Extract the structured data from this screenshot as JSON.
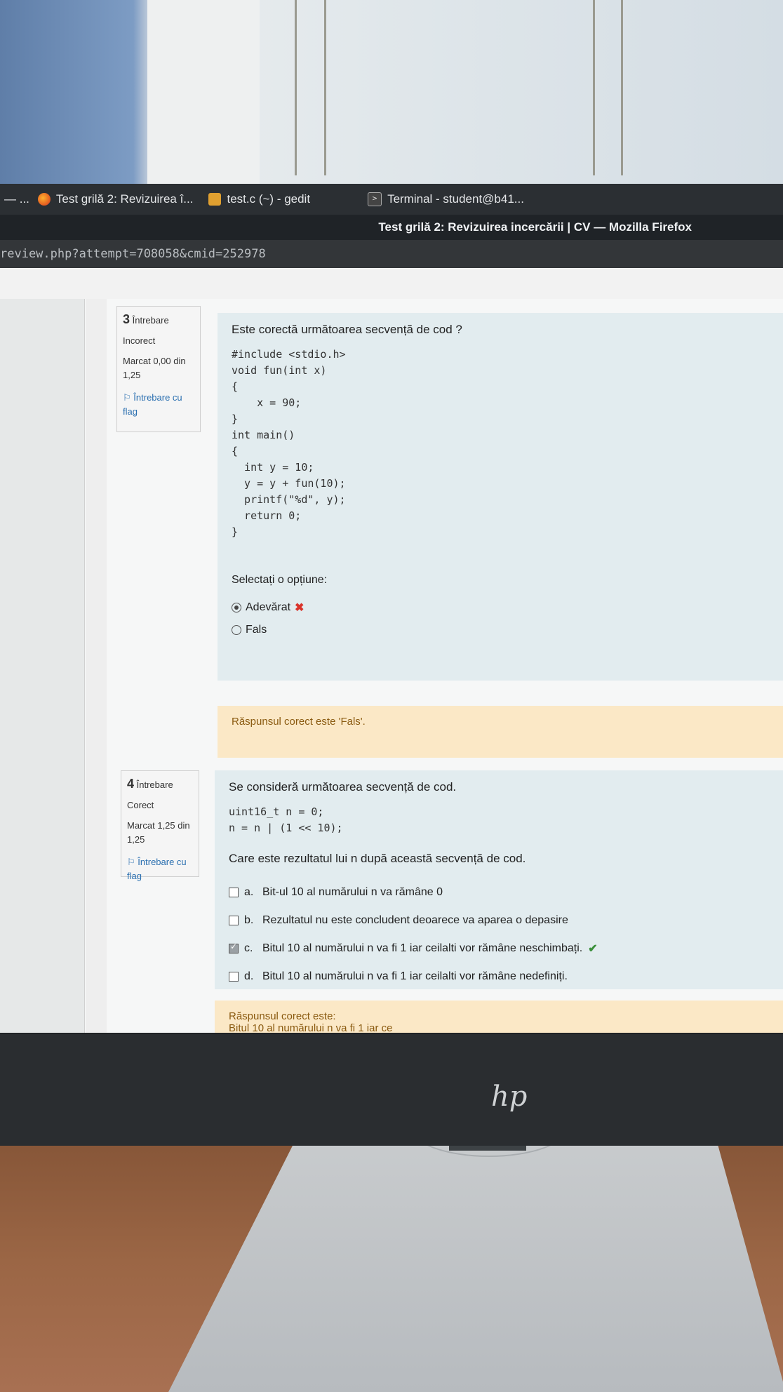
{
  "taskbar": {
    "items": [
      {
        "label": "Test grilă 2: Revizuirea î...",
        "icon": "firefox-icon"
      },
      {
        "label": "test.c (~) - gedit",
        "icon": "gedit-icon"
      },
      {
        "label": "Terminal - student@b41...",
        "icon": "terminal-icon"
      }
    ],
    "prefix": "— ..."
  },
  "window": {
    "title": "Test grilă 2: Revizuirea incercării | CV — Mozilla Firefox",
    "url": "review.php?attempt=708058&cmid=252978"
  },
  "questions": [
    {
      "number": "3",
      "label": "Întrebare",
      "state": "Incorect",
      "grade": "Marcat 0,00 din 1,25",
      "flag": "Întrebare cu flag",
      "text": "Este corectă următoarea secvență de cod ?",
      "code": "#include <stdio.h>\nvoid fun(int x)\n{\n    x = 90;\n}\nint main()\n{\n  int y = 10;\n  y = y + fun(10);\n  printf(\"%d\", y);\n  return 0;\n}",
      "prompt": "Selectați o opțiune:",
      "options": [
        {
          "label": "Adevărat",
          "selected": true,
          "mark": "incorrect"
        },
        {
          "label": "Fals",
          "selected": false,
          "mark": ""
        }
      ],
      "feedback": "Răspunsul corect este 'Fals'."
    },
    {
      "number": "4",
      "label": "Întrebare",
      "state": "Corect",
      "grade": "Marcat 1,25 din 1,25",
      "flag": "Întrebare cu flag",
      "text": "Se consideră următoarea secvență de cod.",
      "code": "uint16_t n = 0;\nn = n | (1 << 10);",
      "text2": "Care este rezultatul lui n după această secvență de cod.",
      "options": [
        {
          "letter": "a.",
          "label": "Bit-ul 10 al numărului n va rămâne 0",
          "checked": false
        },
        {
          "letter": "b.",
          "label": "Rezultatul nu este concludent deoarece va aparea o depasire",
          "checked": false
        },
        {
          "letter": "c.",
          "label": "Bitul 10 al numărului n va fi 1 iar ceilalti vor rămâne neschimbați.",
          "checked": true,
          "mark": "correct"
        },
        {
          "letter": "d.",
          "label": "Bitul 10 al numărului n va fi 1 iar ceilalti vor rămâne nedefiniți.",
          "checked": false
        }
      ],
      "feedback_title": "Răspunsul corect este:",
      "feedback": "Bitul 10 al numărului n va fi 1 iar ce"
    }
  ],
  "colors": {
    "question_bg": "#e2ecef",
    "feedback_bg": "#fbe8c6",
    "incorrect": "#d9342b",
    "correct": "#3a8f3a",
    "link": "#2a6fb0"
  }
}
